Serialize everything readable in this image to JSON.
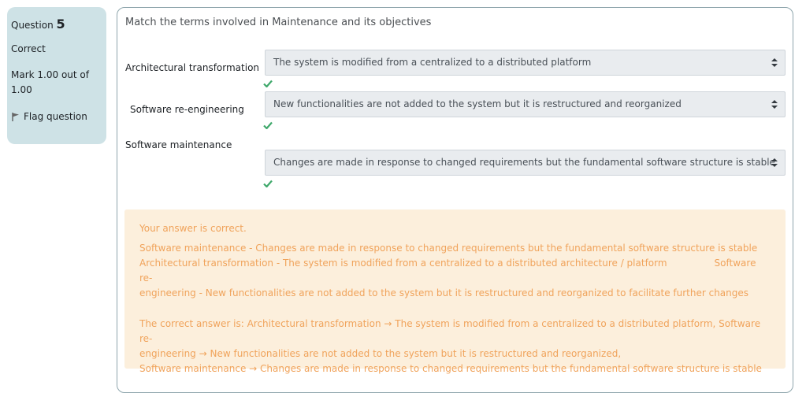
{
  "info": {
    "question_label": "Question",
    "question_number": "5",
    "state": "Correct",
    "grade": "Mark 1.00 out of 1.00",
    "flag_label": "Flag question",
    "flag_icon": "flag-icon"
  },
  "question": {
    "prompt": "Match the terms involved in Maintenance and its objectives",
    "rows": [
      {
        "term": "Architectural transformation",
        "selected": "The system is modified from a centralized to a distributed platform",
        "status_icon": "check-icon"
      },
      {
        "term": "Software re-engineering",
        "selected": "New functionalities are not added to the system but it is restructured and reorganized",
        "status_icon": "check-icon"
      },
      {
        "term": "Software maintenance",
        "selected": "Changes are made in response to changed requirements but the fundamental software structure is stable",
        "status_icon": "check-icon"
      }
    ]
  },
  "feedback": {
    "status": "Your answer is correct.",
    "general_line1": "Software maintenance - Changes are made in response to changed requirements but the fundamental software structure is stable",
    "general_line2a": "Architectural transformation - The system is modified from a centralized to a distributed architecture / platform",
    "general_line2b": "Software re-",
    "general_line3": "engineering - New functionalities are not added to the system but it is restructured and reorganized to facilitate further changes",
    "right_line1": "The correct answer is: Architectural transformation  → The system is modified from a centralized to a distributed platform,   Software re-",
    "right_line2": "engineering  → New functionalities are not added to the system but it is restructured and reorganized,",
    "right_line3": "Software maintenance  → Changes are made in response to changed requirements but the fundamental software structure is stable"
  },
  "colors": {
    "info_bg": "#cee2e6",
    "feedback_bg": "#fcefdc",
    "feedback_text": "#f0a35b",
    "check": "#3fa86b"
  }
}
